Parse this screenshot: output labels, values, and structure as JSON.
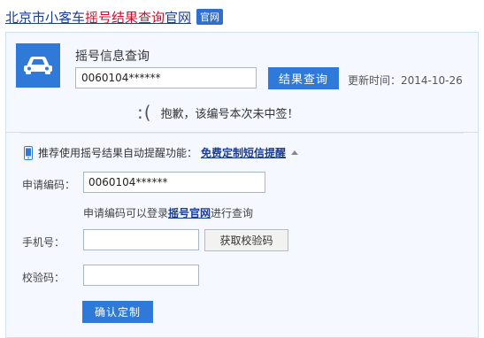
{
  "header": {
    "title_prefix": "北京市小客车",
    "title_highlight": "摇号结果查询",
    "title_suffix": "官网",
    "badge": "官网"
  },
  "query": {
    "title": "摇号信息查询",
    "input_value": "0060104******",
    "button_label": "结果查询",
    "update_label": "更新时间：",
    "update_date": "2014-10-26",
    "sad_face": ":(",
    "result_message": "抱歉，该编号本次未中签！"
  },
  "reminder": {
    "promo_text": "推荐使用摇号结果自动提醒功能：",
    "promo_link": "免费定制短信提醒",
    "apply_code_label": "申请编码：",
    "apply_code_value": "0060104******",
    "helper_prefix": "申请编码可以登录",
    "helper_link": "摇号官网",
    "helper_suffix": "进行查询",
    "phone_label": "手机号：",
    "phone_value": "",
    "get_code_button": "获取校验码",
    "verify_label": "校验码：",
    "verify_value": "",
    "confirm_button": "确认定制"
  },
  "icons": {
    "car": "car-icon",
    "phone": "mobile-phone-icon",
    "caret": "caret-up-icon"
  },
  "colors": {
    "accent_blue": "#2f79d8",
    "link_blue": "#1a3d9a",
    "highlight_red": "#c8102e",
    "panel_background": "#f5f9ff"
  }
}
